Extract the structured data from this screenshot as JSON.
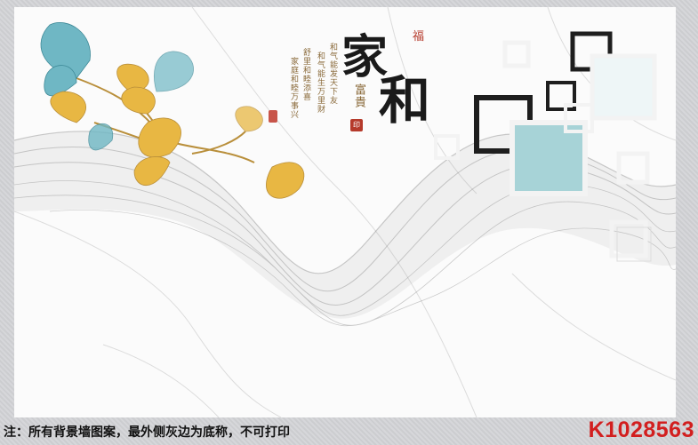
{
  "artwork": {
    "main_calligraphy_1": "家",
    "main_calligraphy_2": "和",
    "small_red_char": "福",
    "fugui_text": "富貴",
    "poem_lines": [
      "和气能发天下友",
      "和气能生万里财",
      "舒里和睦添喜",
      "家庭和睦万事兴"
    ]
  },
  "footer": {
    "note": "注：所有背景墙图案，最外侧灰边为底称，不可打印",
    "product_code": "K1028563"
  },
  "colors": {
    "gold_leaf": "#e8b743",
    "teal_leaf": "#6fb7c4",
    "frame_black": "#1e1e1e",
    "frame_teal": "#a7d3d7",
    "code_red": "#d21f1f"
  }
}
